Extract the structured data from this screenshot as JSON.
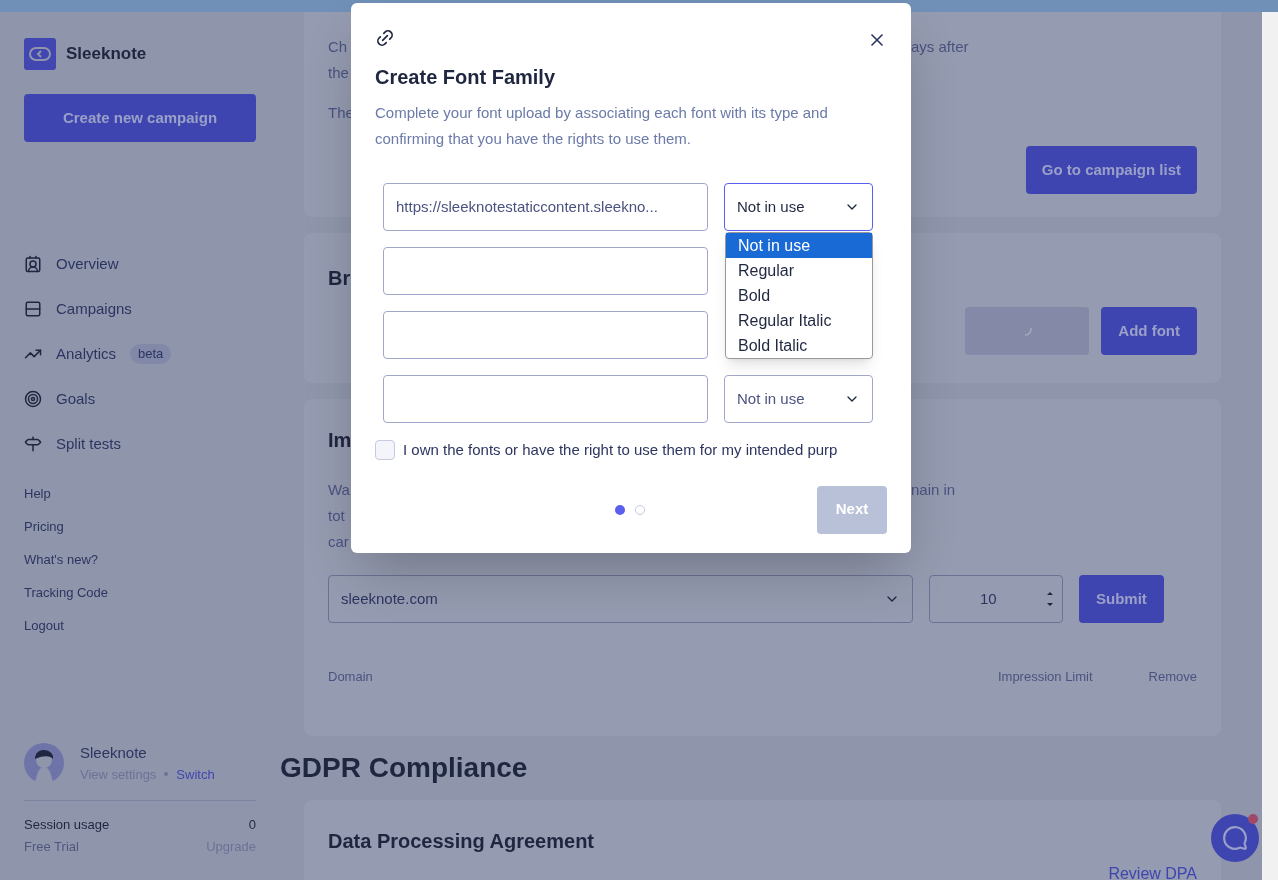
{
  "sidebar": {
    "brand": "Sleeknote",
    "create_button": "Create new campaign",
    "nav": [
      {
        "label": "Overview"
      },
      {
        "label": "Campaigns"
      },
      {
        "label": "Analytics",
        "badge": "beta"
      },
      {
        "label": "Goals"
      },
      {
        "label": "Split tests"
      }
    ],
    "links": [
      "Help",
      "Pricing",
      "What's new?",
      "Tracking Code",
      "Logout"
    ],
    "profile": {
      "name": "Sleeknote",
      "settings": "View settings",
      "switch": "Switch"
    },
    "usage": {
      "label": "Session usage",
      "value": "0",
      "plan": "Free Trial",
      "upgrade": "Upgrade"
    }
  },
  "main": {
    "card_1": {
      "lines_left": [
        "Ch",
        "the",
        "The"
      ],
      "line_right": "ays after",
      "button": "Go to campaign list"
    },
    "card_2": {
      "heading": "Br",
      "button": "Add font"
    },
    "card_3": {
      "heading": "Im",
      "lines_left": [
        "Wa",
        "tot",
        "car"
      ],
      "line_right": "nain in",
      "domain_select": "sleeknote.com",
      "limit_value": "10",
      "submit": "Submit",
      "columns": [
        "Domain",
        "Impression Limit",
        "Remove"
      ]
    },
    "section_title": "GDPR Compliance",
    "card_4": {
      "heading": "Data Processing Agreement",
      "link": "Review DPA"
    }
  },
  "modal": {
    "title": "Create Font Family",
    "description": "Complete your font upload by associating each font with its type and confirming that you have the rights to use them.",
    "rows": [
      {
        "url": "https://sleeknotestaticcontent.sleekno...",
        "select": "Not in use",
        "open": true
      },
      {},
      {},
      {
        "select": "Not in use",
        "open": false
      }
    ],
    "options": [
      {
        "label": "Not in use",
        "selected": true
      },
      {
        "label": "Regular",
        "selected": false
      },
      {
        "label": "Bold",
        "selected": false
      },
      {
        "label": "Regular Italic",
        "selected": false
      },
      {
        "label": "Bold Italic",
        "selected": false
      }
    ],
    "consent": {
      "label": "I own the fonts or have the right to use them for my intended purp",
      "checked": false
    },
    "steps": [
      {
        "selected": true
      },
      {
        "selected": false
      }
    ],
    "next_button": {
      "label": "Next",
      "disabled": true
    }
  }
}
